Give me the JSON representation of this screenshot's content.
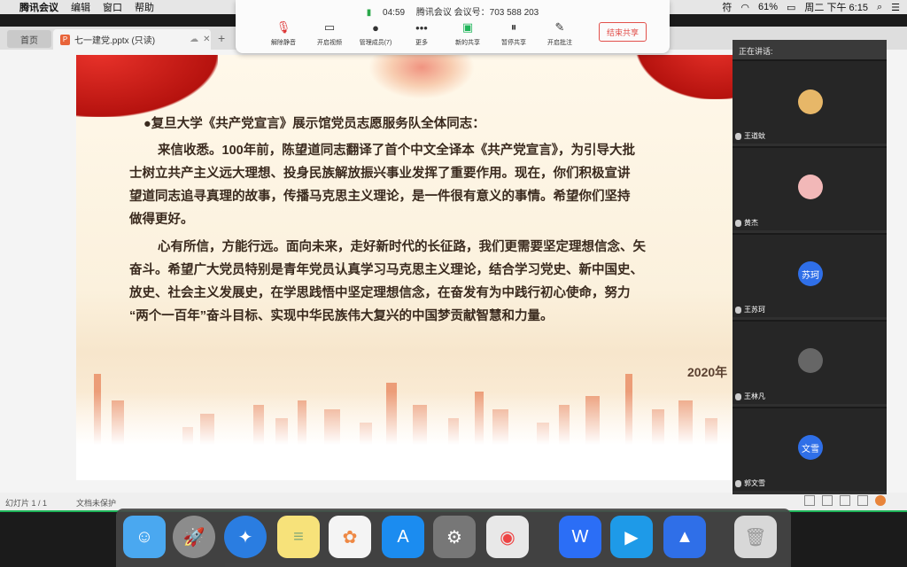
{
  "menubar": {
    "app": "腾讯会议",
    "items": [
      "编辑",
      "窗口",
      "帮助"
    ],
    "status_right": {
      "battery": "61%",
      "datetime": "周二 下午 6:15",
      "input": "符"
    }
  },
  "meeting_toolbar": {
    "timer": "04:59",
    "meeting_id": "腾讯会议 会议号：703 588 203",
    "buttons": [
      "解除静音",
      "开启视频",
      "管理成员(7)",
      "更多",
      "新的共享",
      "暂停共享",
      "开启批注"
    ],
    "stop_share": "结束共享"
  },
  "wps": {
    "home_tab": "首页",
    "doc_tab": "七一建党.pptx (只读)",
    "status": {
      "slide": "幻灯片 1 / 1",
      "protect": "文档未保护"
    }
  },
  "slide": {
    "salute": "●复旦大学《共产党宣言》展示馆党员志愿服务队全体同志：",
    "lines": [
      "来信收悉。100年前，陈望道同志翻译了首个中文全译本《共产党宣言》，为引导大批",
      "士树立共产主义远大理想、投身民族解放振兴事业发挥了重要作用。现在，你们积极宣讲",
      "望道同志追寻真理的故事，传播马克思主义理论，是一件很有意义的事情。希望你们坚持",
      "做得更好。",
      "心有所信，方能行远。面向未来，走好新时代的长征路，我们更需要坚定理想信念、矢",
      "奋斗。希望广大党员特别是青年党员认真学习马克思主义理论，结合学习党史、新中国史、",
      "放史、社会主义发展史，在学思践悟中坚定理想信念，在奋发有为中践行初心使命，努力",
      "“两个一百年”奋斗目标、实现中华民族伟大复兴的中国梦贡献智慧和力量。"
    ],
    "date": "2020年"
  },
  "panel": {
    "header": "正在讲话:",
    "participants": [
      {
        "name": "王道蚊",
        "avatar": ""
      },
      {
        "name": "黄杰",
        "avatar": ""
      },
      {
        "name": "王苏珂",
        "avatar": "苏珂"
      },
      {
        "name": "王林凡",
        "avatar": ""
      },
      {
        "name": "郭文雪",
        "avatar": "文雪"
      }
    ]
  },
  "colors": {
    "accent_green": "#1fb55a",
    "stop_red": "#e2504b",
    "avatar_blue": "#2f6fe8"
  },
  "dock": [
    "finder",
    "launchpad",
    "safari",
    "notes",
    "photos",
    "app-store",
    "system-preferences",
    "screenshot-tool",
    "wps",
    "tencent-video",
    "tencent-meeting",
    "trash"
  ]
}
